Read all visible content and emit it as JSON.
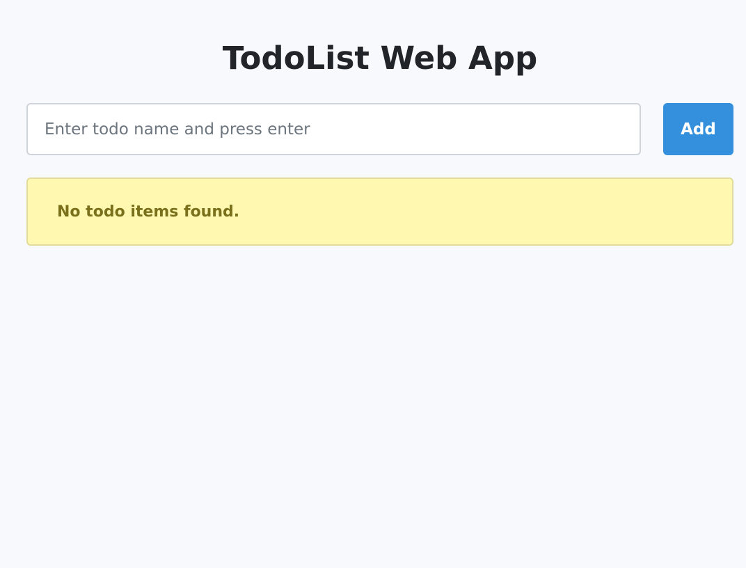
{
  "header": {
    "title": "TodoList Web App"
  },
  "form": {
    "input_value": "",
    "input_placeholder": "Enter todo name and press enter",
    "add_label": "Add"
  },
  "alert": {
    "message": "No todo items found."
  },
  "colors": {
    "background": "#f7f9fd",
    "primary": "#3490dc",
    "alert_background": "#fff8b0",
    "alert_border": "#e1dc9b",
    "alert_text": "#7a701c",
    "title_text": "#212529"
  }
}
